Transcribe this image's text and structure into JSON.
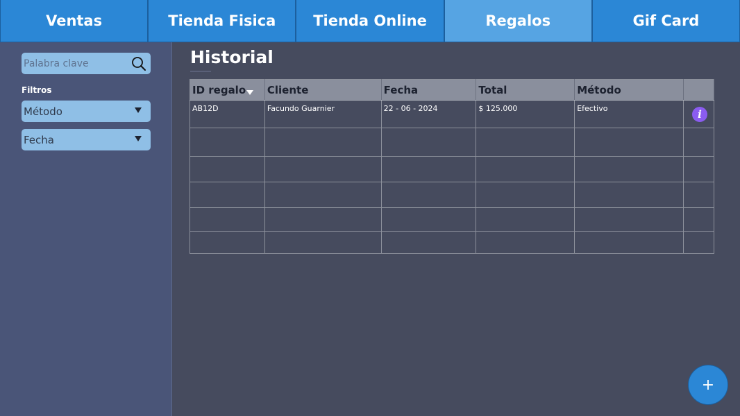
{
  "tabs": [
    {
      "label": "Ventas",
      "active": false
    },
    {
      "label": "Tienda Fisica",
      "active": false
    },
    {
      "label": "Tienda Online",
      "active": false
    },
    {
      "label": "Regalos",
      "active": true
    },
    {
      "label": "Gif Card",
      "active": false
    }
  ],
  "sidebar": {
    "search": {
      "placeholder": "Palabra clave",
      "value": "",
      "icon": "search-icon"
    },
    "filters_title": "Filtros",
    "filters": [
      {
        "label": "Método",
        "icon": "dropdown-arrow-icon"
      },
      {
        "label": "Fecha",
        "icon": "dropdown-arrow-icon"
      }
    ]
  },
  "main": {
    "title": "Historial",
    "table": {
      "columns": [
        "ID regalo",
        "Cliente",
        "Fecha",
        "Total",
        "Método",
        ""
      ],
      "sorted_column": "ID regalo",
      "rows": [
        [
          "AB12D",
          "Facundo Guarnier",
          "22 - 06 - 2024",
          "$ 125.000",
          "Efectivo",
          ""
        ],
        [
          "",
          "",
          "",
          "",
          "",
          ""
        ],
        [
          "",
          "",
          "",
          "",
          "",
          ""
        ],
        [
          "",
          "",
          "",
          "",
          "",
          ""
        ],
        [
          "",
          "",
          "",
          "",
          "",
          ""
        ],
        [
          "",
          "",
          "",
          "",
          "",
          ""
        ]
      ],
      "info_icon_label": "i"
    },
    "add_button_label": "+"
  },
  "colors": {
    "background": "#464b5e",
    "tab_bar": "#2b87d6",
    "tab_active": "#56a4e3",
    "sidebar": "#4a5578",
    "input_fill": "#8fbfe6",
    "table_header": "#8a8f9d",
    "info_icon": "#8b5cf0"
  }
}
